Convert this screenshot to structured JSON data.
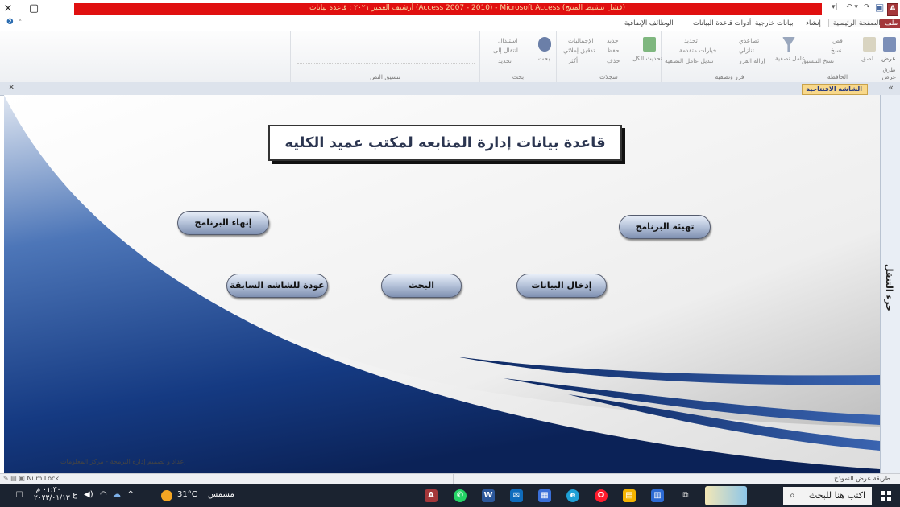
{
  "window": {
    "title": "أرشيف العمير ٢٠٢١ : قاعدة بيانات (Access 2007 - 2010) - Microsoft Access (فشل تنشيط المنتج)",
    "close_glyph": "×",
    "restore_glyph": "▢",
    "help_glyph": "?",
    "qat_access_letter": "A"
  },
  "menu": {
    "file": "ملف",
    "tabs": [
      "الصفحة الرئيسية",
      "إنشاء",
      "بيانات خارجية",
      "أدوات قاعدة البيانات",
      "الوظائف الإضافية"
    ]
  },
  "ribbon": {
    "views": {
      "item": "عرض",
      "label": "طرق عرض"
    },
    "clipboard": {
      "cut": "قص",
      "copy": "نسخ",
      "paste": "لصق",
      "format_painter": "نسخ التنسيق",
      "label": "الحافظة"
    },
    "sort_filter": {
      "ascending": "تصاعدي",
      "descending": "تنازلي",
      "remove_sort": "إزالة الفرز",
      "selection": "تحديد",
      "advanced": "خيارات متقدمة",
      "toggle_filter": "تبديل عامل التصفية",
      "filter": "عامل تصفية",
      "label": "فرز وتصفية"
    },
    "records": {
      "new": "جديد",
      "save": "حفظ",
      "delete": "حذف",
      "totals": "الإجماليات",
      "spelling": "تدقيق إملائي",
      "more": "أكثر",
      "refresh": "تحديث الكل",
      "label": "سجلات"
    },
    "find": {
      "find": "بحث",
      "replace": "استبدال",
      "goto": "انتقال إلى",
      "select": "تحديد",
      "label": "بحث"
    },
    "text_format": {
      "label": "تنسيق النص"
    }
  },
  "nav": {
    "pane_label": "جزء التنقل",
    "tab_label": "الشاشة الافتتاحية",
    "collapse_glyph": "«",
    "close_glyph": "×"
  },
  "form": {
    "heading": "قاعدة بيانات إدارة المتابعه لمكتب عميد الكليه",
    "buttons": {
      "exit": "إنهاء البرنامج",
      "setup": "تهيئة البرنامج",
      "back": "عودة للشاشه السابقة",
      "search": "البحث",
      "data_entry": "إدخال البيانات"
    },
    "credits": "إعداد و تصميم إدارة البرمجة - مركز المعلومات",
    "colors": {
      "dark_blue": "#0d2a6b",
      "mid_blue": "#2d5aa8",
      "pill_top": "#e8eef8",
      "pill_bottom": "#7f90b1"
    }
  },
  "status": {
    "num_lock": "Num Lock",
    "view": "طريقة عرض النموذج"
  },
  "taskbar": {
    "search_placeholder": "اكتب هنا للبحث",
    "weather_temp": "31°C",
    "weather_text": "مشمس",
    "time": "٠١:٣٠ م",
    "date": "٢٠٢٣/٠١/١٣",
    "lang": "ع",
    "icons": [
      "windows-start",
      "search",
      "task-view",
      "file-explorer",
      "opera",
      "microsoft-store",
      "edge",
      "chrome",
      "mail",
      "word",
      "whatsapp",
      "access"
    ]
  }
}
